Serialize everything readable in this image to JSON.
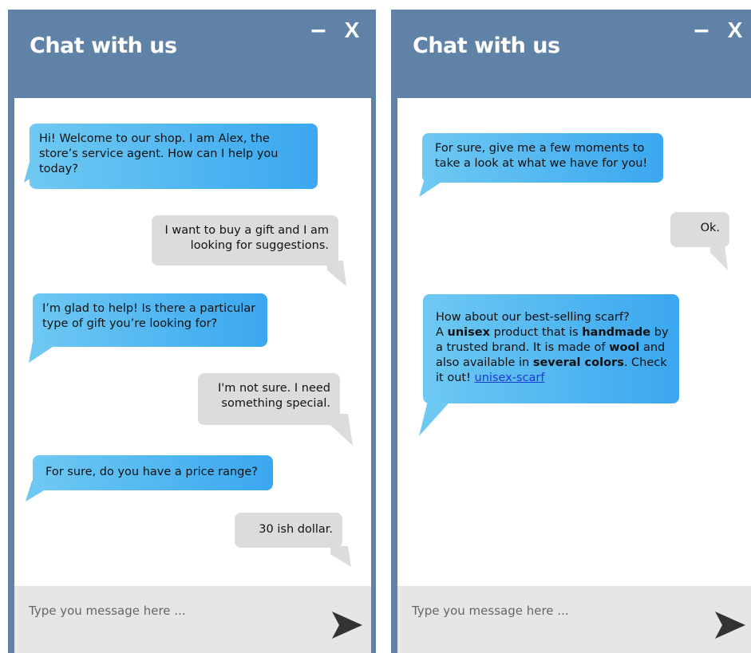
{
  "colors": {
    "header": "#5f82a6",
    "agent_bubble_from": "#6ec9f2",
    "agent_bubble_to": "#3aa7f0",
    "user_bubble": "#dcdcdc",
    "input_bar": "#e6e6e6",
    "link": "#1a38d6"
  },
  "left": {
    "title": "Chat with us",
    "minimize_label": "–",
    "close_label": "X",
    "messages": [
      {
        "from": "agent",
        "text": "Hi! Welcome to our shop. I am Alex, the store’s service agent. How can I help you today?"
      },
      {
        "from": "user",
        "text": "I want to buy a gift and I am looking for suggestions."
      },
      {
        "from": "agent",
        "text": "I’m glad to help! Is there a particular type of gift you’re looking for?"
      },
      {
        "from": "user",
        "text": "I'm not sure. I need something special."
      },
      {
        "from": "agent",
        "text": "For sure, do you have a price range?"
      },
      {
        "from": "user",
        "text": "30 ish dollar."
      }
    ],
    "input_placeholder": "Type you message here ..."
  },
  "right": {
    "title": "Chat with us",
    "minimize_label": "–",
    "close_label": "X",
    "messages": [
      {
        "from": "agent",
        "text": "For sure, give me a few moments to take a look at what we have for you!"
      },
      {
        "from": "user",
        "text": "Ok."
      }
    ],
    "product_message": {
      "line1": "How about our best-selling scarf?",
      "p1": "A ",
      "b1": "unisex",
      "p2": " product that is ",
      "b2": "handmade",
      "p3": " by a trusted brand. It is made of ",
      "b3": "wool",
      "p4": " and also available in ",
      "b4": "several colors",
      "p5": ". Check it out! ",
      "link": "unisex-scarf"
    },
    "input_placeholder": "Type you message here ..."
  },
  "icons": {
    "send": "send-arrow-icon",
    "minimize": "minimize-icon",
    "close": "close-icon"
  }
}
